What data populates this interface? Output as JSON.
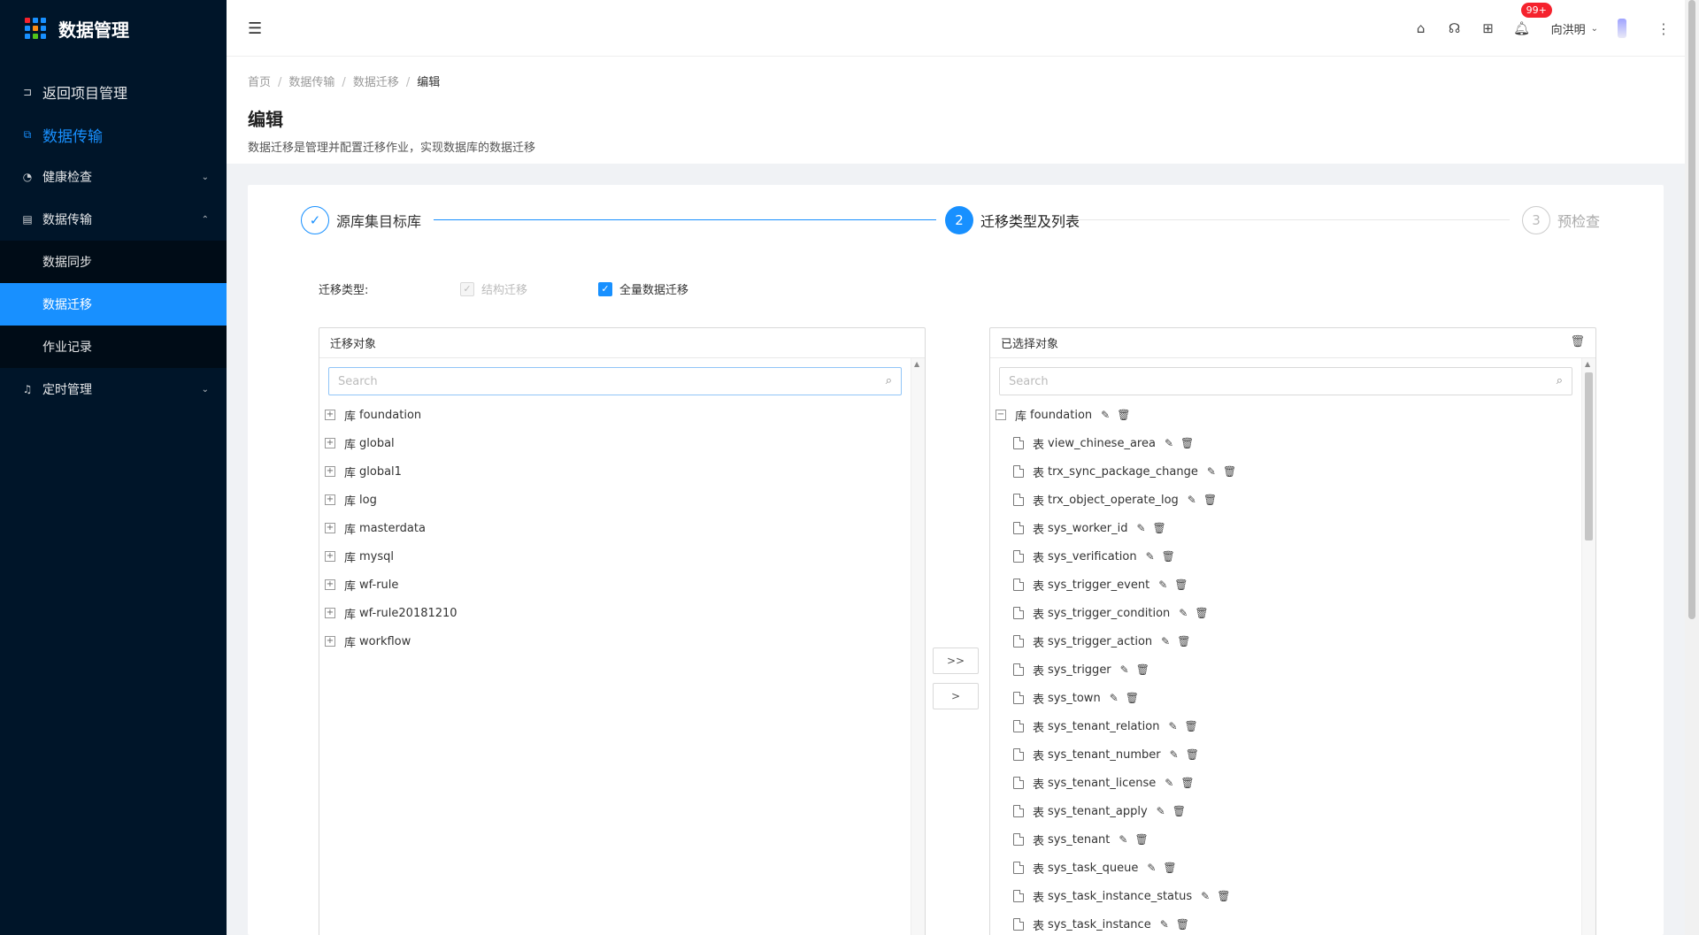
{
  "sidebar": {
    "title": "数据管理",
    "logo_colors": [
      "#f5222d",
      "#1890ff",
      "#1890ff",
      "#1890ff",
      "#fa8c16",
      "#1890ff",
      "#1890ff",
      "#52c41a",
      "#1890ff"
    ],
    "back": {
      "label": "返回项目管理",
      "icon": "back-icon"
    },
    "section": {
      "label": "数据传输",
      "icon": "transfer-icon"
    },
    "health": {
      "label": "健康检查",
      "icon": "dashboard-icon"
    },
    "transfer": {
      "label": "数据传输",
      "icon": "database-icon"
    },
    "sub": [
      {
        "label": "数据同步"
      },
      {
        "label": "数据迁移"
      },
      {
        "label": "作业记录"
      }
    ],
    "schedule": {
      "label": "定时管理",
      "icon": "bell-icon"
    }
  },
  "header": {
    "badge": "99+",
    "user": "向洪明"
  },
  "page": {
    "breadcrumb": [
      "首页",
      "数据传输",
      "数据迁移",
      "编辑"
    ],
    "title": "编辑",
    "desc": "数据迁移是管理并配置迁移作业，实现数据库的数据迁移"
  },
  "steps": [
    {
      "num": "",
      "title": "源库集目标库",
      "status": "done"
    },
    {
      "num": "2",
      "title": "迁移类型及列表",
      "status": "process"
    },
    {
      "num": "3",
      "title": "预检查",
      "status": "wait"
    }
  ],
  "migration_type": {
    "label": "迁移类型:",
    "options": [
      {
        "label": "结构迁移",
        "checked": true,
        "disabled": true
      },
      {
        "label": "全量数据迁移",
        "checked": true,
        "disabled": false
      }
    ]
  },
  "left_panel": {
    "title": "迁移对象",
    "search_placeholder": "Search",
    "kind": "库",
    "items": [
      "foundation",
      "global",
      "global1",
      "log",
      "masterdata",
      "mysql",
      "wf-rule",
      "wf-rule20181210",
      "workflow"
    ]
  },
  "buttons": {
    "move_all": ">>",
    "move": ">"
  },
  "right_panel": {
    "title": "已选择对象",
    "search_placeholder": "Search",
    "db_kind": "库",
    "table_kind": "表",
    "db": "foundation",
    "tables": [
      "view_chinese_area",
      "trx_sync_package_change",
      "trx_object_operate_log",
      "sys_worker_id",
      "sys_verification",
      "sys_trigger_event",
      "sys_trigger_condition",
      "sys_trigger_action",
      "sys_trigger",
      "sys_town",
      "sys_tenant_relation",
      "sys_tenant_number",
      "sys_tenant_license",
      "sys_tenant_apply",
      "sys_tenant",
      "sys_task_queue",
      "sys_task_instance_status",
      "sys_task_instance"
    ]
  },
  "colors": {
    "primary": "#1890ff",
    "sidebar": "#001529",
    "submenu": "#000c17"
  }
}
